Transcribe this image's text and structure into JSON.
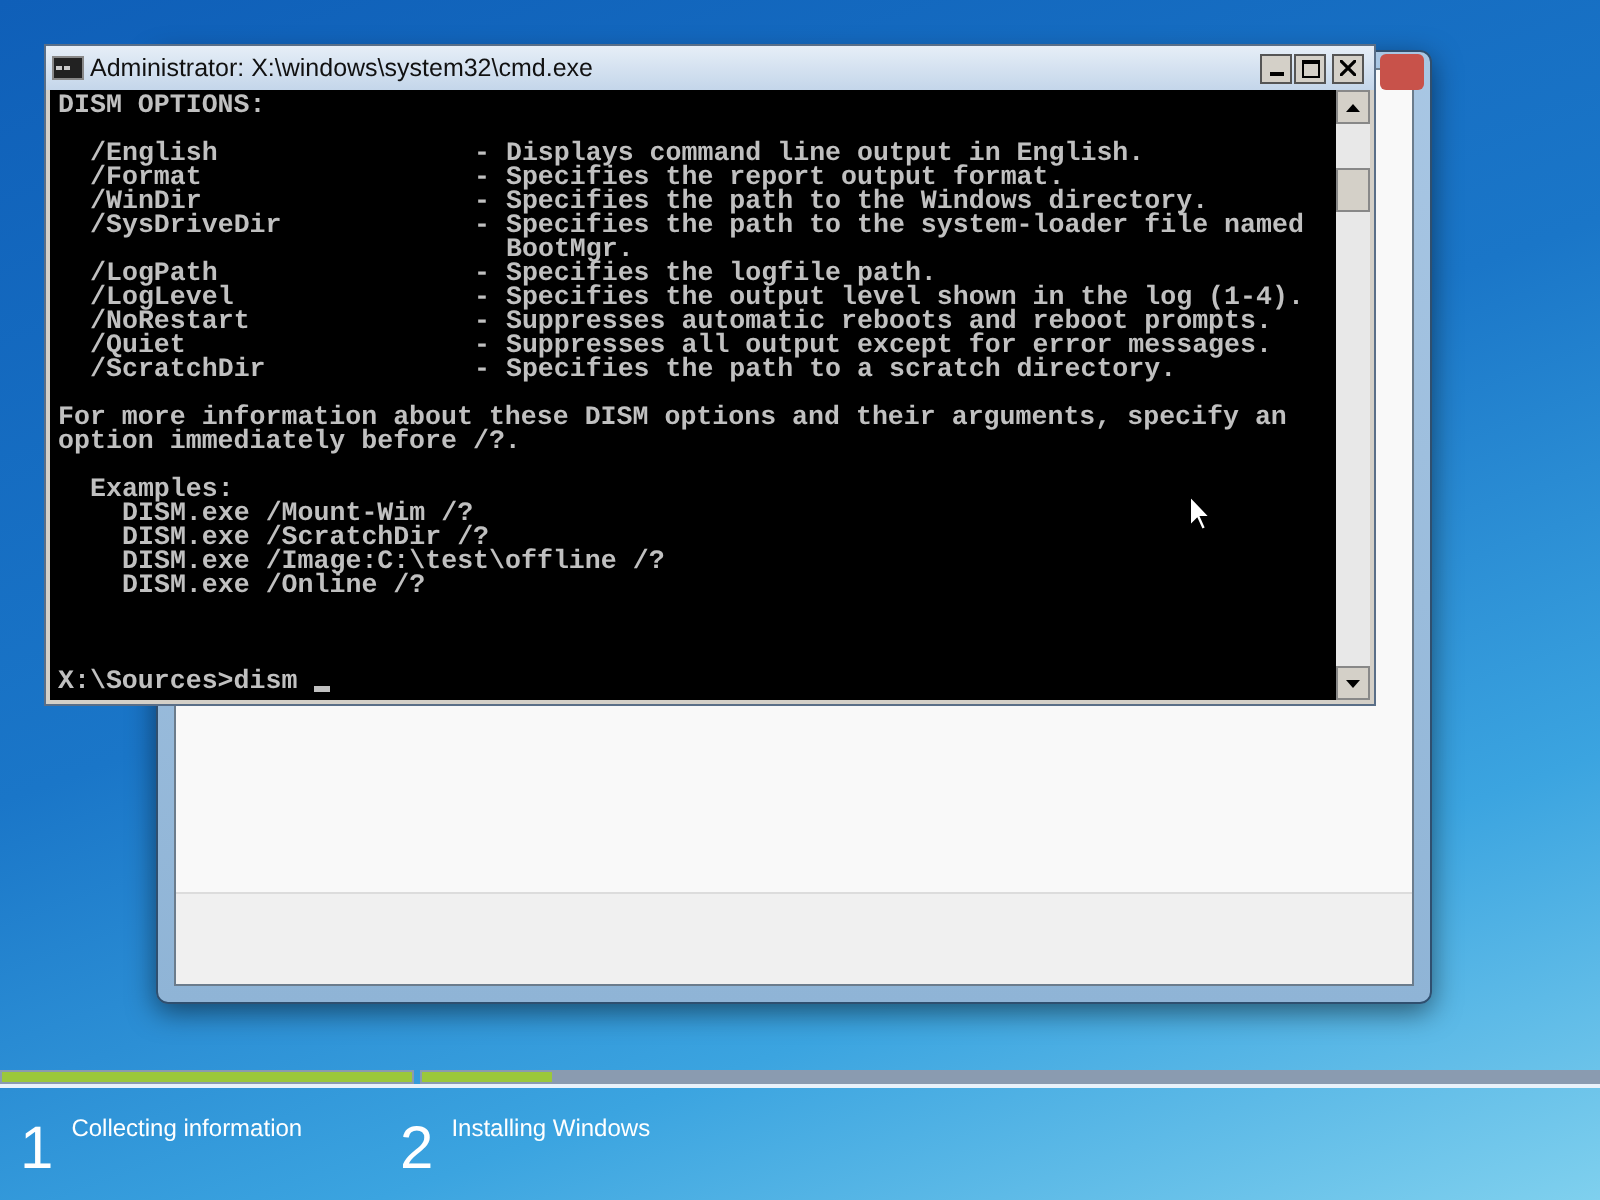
{
  "console_window": {
    "title": "Administrator: X:\\windows\\system32\\cmd.exe",
    "heading": "DISM OPTIONS:",
    "options": [
      {
        "flag": "/English",
        "lines": [
          "- Displays command line output in English."
        ]
      },
      {
        "flag": "/Format",
        "lines": [
          "- Specifies the report output format."
        ]
      },
      {
        "flag": "/WinDir",
        "lines": [
          "- Specifies the path to the Windows directory."
        ]
      },
      {
        "flag": "/SysDriveDir",
        "lines": [
          "- Specifies the path to the system-loader file named",
          "BootMgr."
        ]
      },
      {
        "flag": "/LogPath",
        "lines": [
          "- Specifies the logfile path."
        ]
      },
      {
        "flag": "/LogLevel",
        "lines": [
          "- Specifies the output level shown in the log (1-4)."
        ]
      },
      {
        "flag": "/NoRestart",
        "lines": [
          "- Suppresses automatic reboots and reboot prompts."
        ]
      },
      {
        "flag": "/Quiet",
        "lines": [
          "- Suppresses all output except for error messages."
        ]
      },
      {
        "flag": "/ScratchDir",
        "lines": [
          "- Specifies the path to a scratch directory."
        ]
      }
    ],
    "note": [
      "For more information about these DISM options and their arguments, specify an",
      "option immediately before /?."
    ],
    "examples_heading": "Examples:",
    "examples": [
      "DISM.exe /Mount-Wim /?",
      "DISM.exe /ScratchDir /?",
      "DISM.exe /Image:C:\\test\\offline /?",
      "DISM.exe /Online /?"
    ],
    "prompt": "X:\\Sources>dism"
  },
  "steps": [
    {
      "number": "1",
      "label": "Collecting information",
      "level": 1
    },
    {
      "number": "2",
      "label": "Installing Windows",
      "level": 0.11
    }
  ]
}
